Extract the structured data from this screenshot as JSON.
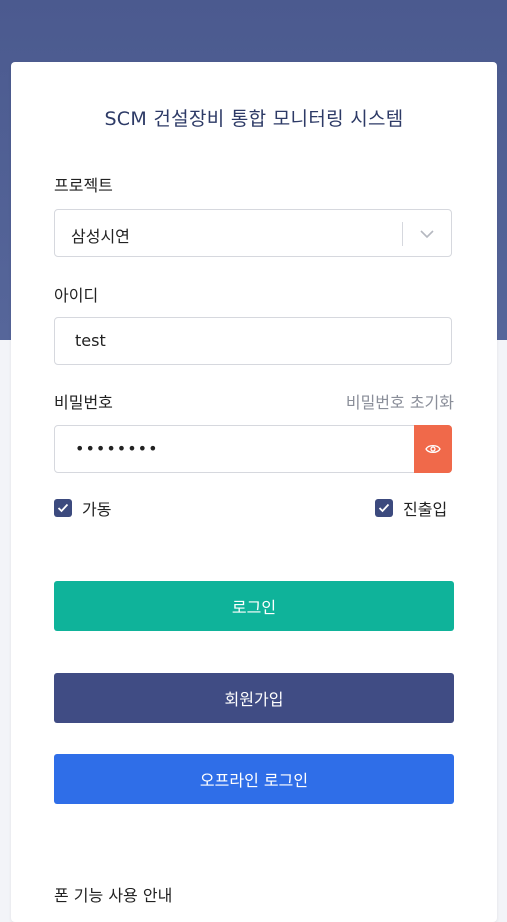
{
  "app": {
    "title": "SCM 건설장비 통합 모니터링 시스템"
  },
  "form": {
    "project_label": "프로젝트",
    "project_value": "삼성시연",
    "id_label": "아이디",
    "id_value": "test",
    "password_label": "비밀번호",
    "password_reset_label": "비밀번호 초기화",
    "password_value": "••••••••"
  },
  "checkboxes": [
    {
      "label": "가동",
      "checked": true
    },
    {
      "label": "진출입",
      "checked": true
    }
  ],
  "buttons": {
    "login": "로그인",
    "signup": "회원가입",
    "offline_login": "오프라인 로그인"
  },
  "footer": {
    "guide_title": "폰 기능 사용 안내"
  },
  "colors": {
    "header_bg": "#4b5a8f",
    "login": "#0fb39a",
    "signup": "#404c84",
    "offline": "#2f6ee8",
    "eye_button": "#f0694a",
    "checkbox": "#3c4a7e"
  },
  "icons": [
    "chevron-down-icon",
    "eye-icon",
    "check-icon"
  ]
}
